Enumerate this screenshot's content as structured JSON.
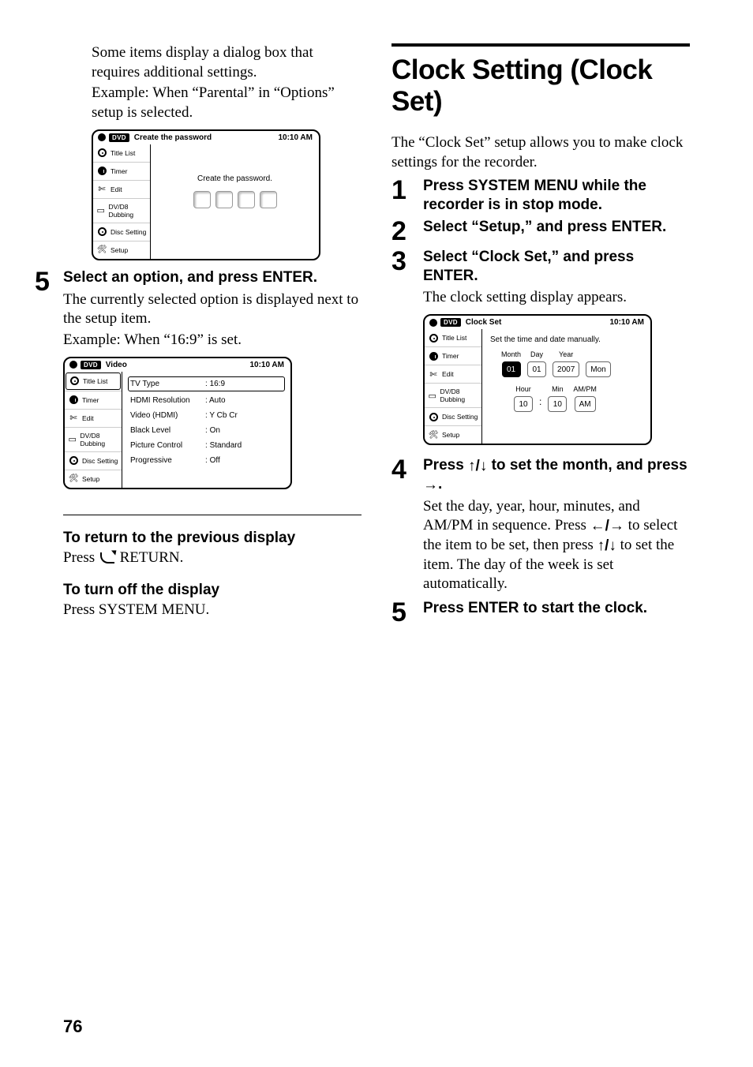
{
  "page_number": "76",
  "left": {
    "intro": [
      "Some items display a dialog box that requires additional settings.",
      "Example: When “Parental” in “Options” setup is selected."
    ],
    "panel1": {
      "chip": "DVD",
      "title": "Create the password",
      "clock": "10:10 AM",
      "prompt": "Create the password."
    },
    "step5": {
      "num": "5",
      "head": "Select an option, and press ENTER.",
      "body": [
        "The currently selected option is displayed next to the setup item.",
        "Example: When “16:9” is set."
      ]
    },
    "panel2": {
      "chip": "DVD",
      "title": "Video",
      "clock": "10:10 AM",
      "rows": [
        {
          "k": "TV Type",
          "v": "16:9",
          "sel": true
        },
        {
          "k": "HDMI Resolution",
          "v": "Auto"
        },
        {
          "k": "Video (HDMI)",
          "v": "Y Cb Cr"
        },
        {
          "k": "Black Level",
          "v": "On"
        },
        {
          "k": "Picture Control",
          "v": "Standard"
        },
        {
          "k": "Progressive",
          "v": "Off"
        }
      ]
    },
    "sub1": {
      "head": "To return to the previous display",
      "body_pre": "Press ",
      "body_post": " RETURN."
    },
    "sub2": {
      "head": "To turn off the display",
      "body": "Press SYSTEM MENU."
    }
  },
  "right": {
    "h1": "Clock Setting (Clock Set)",
    "intro": "The “Clock Set” setup allows you to make clock settings for the recorder.",
    "steps": {
      "s1": {
        "num": "1",
        "head": "Press SYSTEM MENU while the recorder is in stop mode."
      },
      "s2": {
        "num": "2",
        "head": "Select “Setup,” and press ENTER."
      },
      "s3": {
        "num": "3",
        "head": "Select “Clock Set,” and press ENTER.",
        "body": "The clock setting display appears."
      },
      "s4": {
        "num": "4",
        "head_pre": "Press ",
        "head_mid": " to set the month, and press ",
        "head_post": ".",
        "body_pre": "Set the day, year, hour, minutes, and AM/PM in sequence. Press ",
        "body_mid": " to select the item to be set, then press ",
        "body_post": " to set the item. The day of the week is set automatically."
      },
      "s5": {
        "num": "5",
        "head": "Press ENTER to start the clock."
      }
    },
    "panel": {
      "chip": "DVD",
      "title": "Clock Set",
      "clock": "10:10 AM",
      "caption": "Set the time and date manually.",
      "date_labels": {
        "month": "Month",
        "day": "Day",
        "year": "Year"
      },
      "date_vals": {
        "month": "01",
        "day": "01",
        "year": "2007",
        "dow": "Mon"
      },
      "time_labels": {
        "hour": "Hour",
        "min": "Min",
        "ampm": "AM/PM"
      },
      "time_vals": {
        "hour": "10",
        "min": "10",
        "ampm": "AM"
      }
    }
  },
  "nav": {
    "title_list": "Title List",
    "timer": "Timer",
    "edit": "Edit",
    "dub": "DV/D8 Dubbing",
    "disc": "Disc Setting",
    "setup": "Setup"
  },
  "glyphs": {
    "updown": "↑/↓",
    "leftright": "←/→",
    "rightarrow": "→"
  }
}
